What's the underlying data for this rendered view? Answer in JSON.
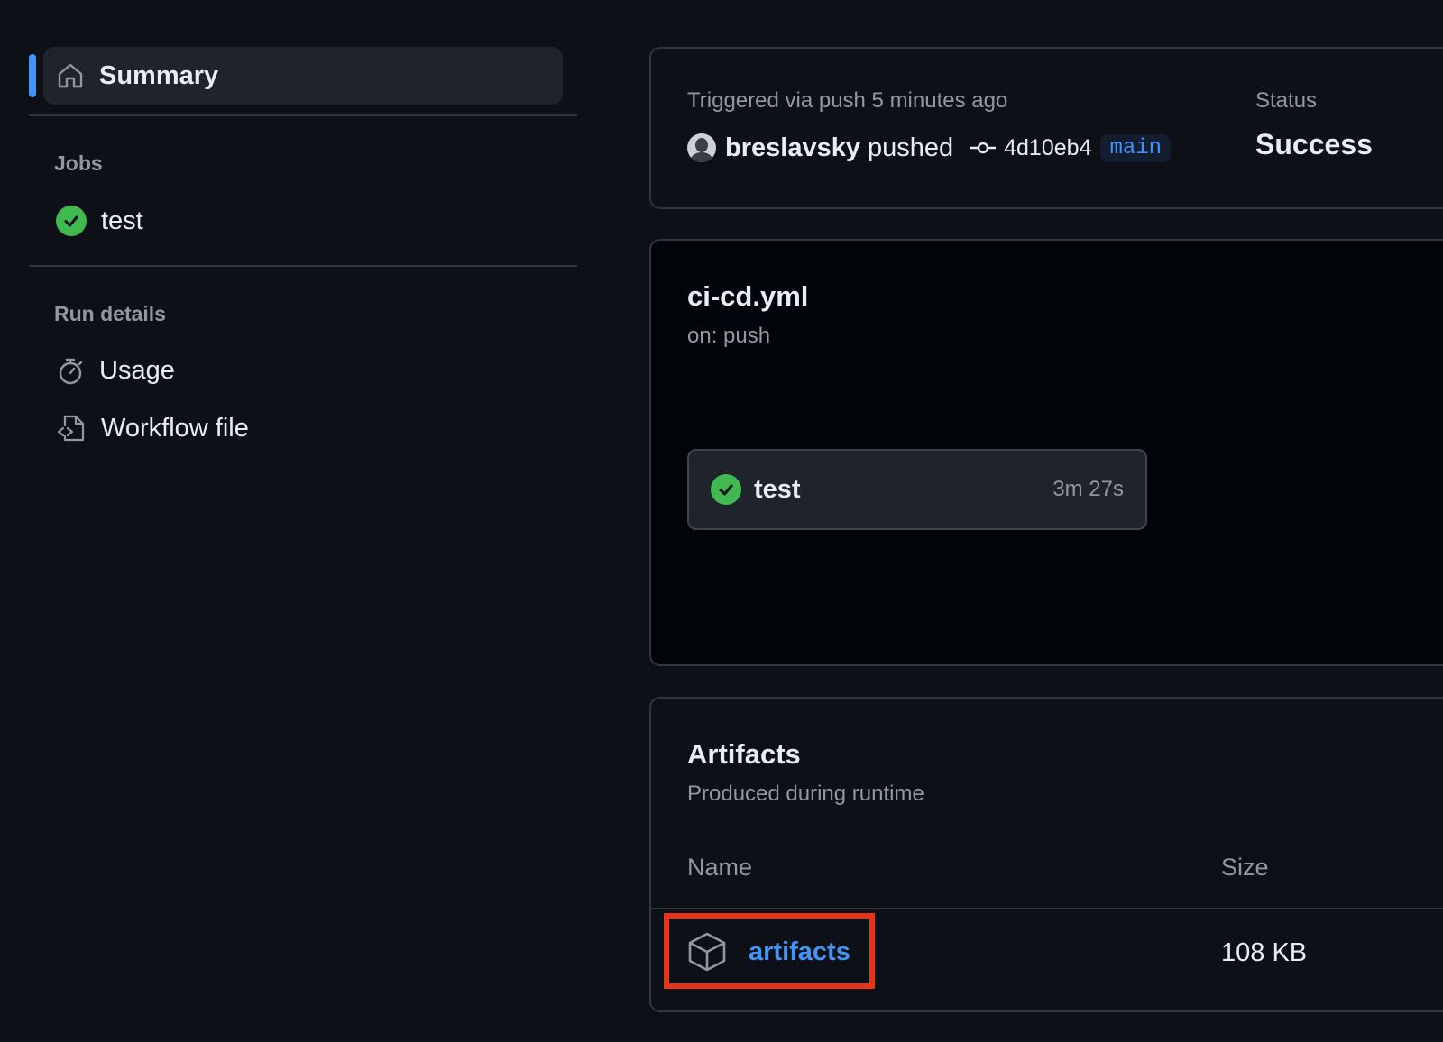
{
  "sidebar": {
    "summary_label": "Summary",
    "jobs_title": "Jobs",
    "jobs": [
      {
        "label": "test",
        "status": "success"
      }
    ],
    "run_details_title": "Run details",
    "run_details": [
      {
        "label": "Usage",
        "icon": "stopwatch-icon"
      },
      {
        "label": "Workflow file",
        "icon": "file-code-icon"
      }
    ]
  },
  "summary": {
    "triggered_text": "Triggered via push 5 minutes ago",
    "actor": "breslavsky",
    "action": "pushed",
    "commit_sha": "4d10eb4",
    "branch": "main",
    "status_label": "Status",
    "status_value": "Success"
  },
  "workflow": {
    "file_name": "ci-cd.yml",
    "trigger": "on: push",
    "job": {
      "name": "test",
      "duration": "3m 27s",
      "status": "success"
    }
  },
  "artifacts": {
    "title": "Artifacts",
    "subtitle": "Produced during runtime",
    "columns": {
      "name": "Name",
      "size": "Size"
    },
    "items": [
      {
        "name": "artifacts",
        "size": "108 KB",
        "icon": "package-icon"
      }
    ]
  },
  "colors": {
    "background": "#0d1117",
    "accent": "#4493f8",
    "success": "#3fb950",
    "highlight": "#e5341a"
  }
}
